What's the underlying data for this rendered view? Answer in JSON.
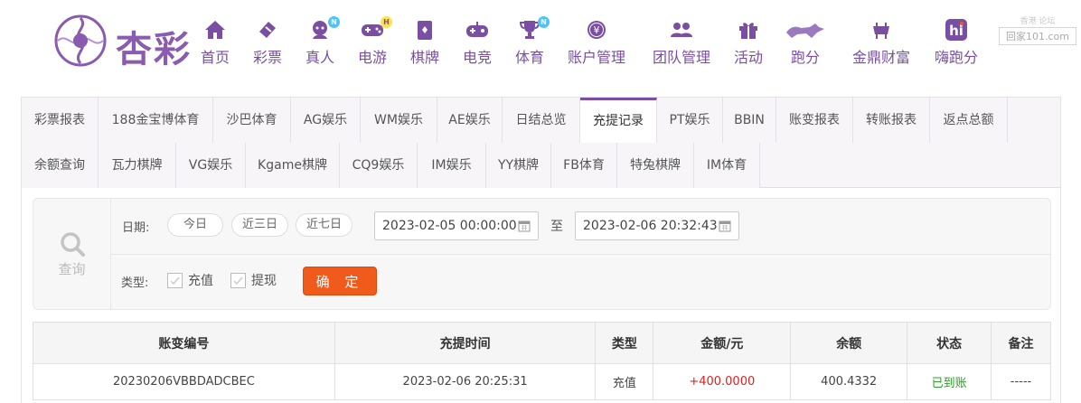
{
  "brand": {
    "logo_text": "杏彩"
  },
  "nav": [
    {
      "label": "首页",
      "icon": "home-icon"
    },
    {
      "label": "彩票",
      "icon": "lottery-ticket-icon"
    },
    {
      "label": "真人",
      "icon": "dealer-face-icon",
      "badge": "N"
    },
    {
      "label": "电游",
      "icon": "gamepad-icon",
      "badge": "H"
    },
    {
      "label": "棋牌",
      "icon": "cards-icon"
    },
    {
      "label": "电竞",
      "icon": "esports-controller-icon"
    },
    {
      "label": "体育",
      "icon": "trophy-icon",
      "badge": "N"
    },
    {
      "label": "账户管理",
      "icon": "yen-coin-icon"
    },
    {
      "label": "团队管理",
      "icon": "team-users-icon"
    },
    {
      "label": "活动",
      "icon": "gift-icon"
    },
    {
      "label": "跑分",
      "icon": "running-dog-icon"
    },
    {
      "label": "金鼎财富",
      "icon": "cauldron-icon"
    },
    {
      "label": "嗨跑分",
      "icon": "hi-app-icon"
    }
  ],
  "watermark": {
    "top": "香港 论坛",
    "main": "回家101.com"
  },
  "tabs_row1": [
    "彩票报表",
    "188金宝博体育",
    "沙巴体育",
    "AG娱乐",
    "WM娱乐",
    "AE娱乐",
    "日结总览",
    "充提记录",
    "PT娱乐",
    "BBIN",
    "账变报表",
    "转账报表",
    "返点总额"
  ],
  "tabs_row2": [
    "余额查询",
    "瓦力棋牌",
    "VG娱乐",
    "Kgame棋牌",
    "CQ9娱乐",
    "IM娱乐",
    "YY棋牌",
    "FB体育",
    "特兔棋牌",
    "IM体育"
  ],
  "active_tab": "充提记录",
  "filter": {
    "query_label": "查询",
    "date_label": "日期:",
    "quick_ranges": [
      "今日",
      "近三日",
      "近七日"
    ],
    "start": "2023-02-05 00:00:00",
    "to_label": "至",
    "end": "2023-02-06 20:32:43",
    "type_label": "类型:",
    "types": [
      {
        "label": "充值",
        "checked": false
      },
      {
        "label": "提现",
        "checked": false
      }
    ],
    "confirm_label": "确 定"
  },
  "table": {
    "headers": [
      "账变编号",
      "充提时间",
      "类型",
      "金额/元",
      "余额",
      "状态",
      "备注"
    ],
    "rows": [
      [
        "20230206VBBDADCBEC",
        "2023-02-06 20:25:31",
        "充值",
        "+400.0000",
        "400.4332",
        "已到账",
        "-----"
      ]
    ]
  },
  "colors": {
    "accent": "#7a4fa3",
    "confirm": "#f05a1a",
    "amount": "#e02020",
    "status_ok": "#2aa02a"
  }
}
